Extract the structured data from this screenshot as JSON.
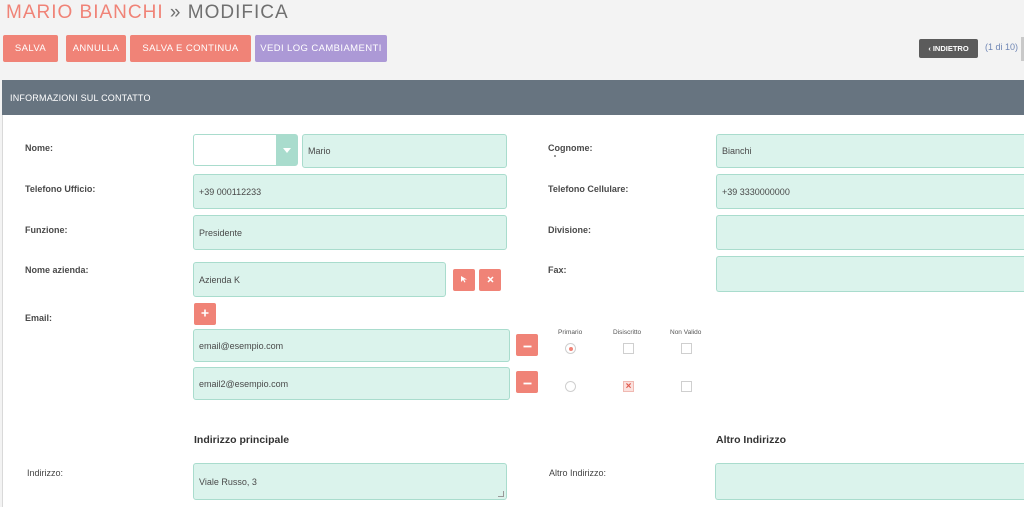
{
  "header": {
    "title_name": "MARIO BIANCHI",
    "title_sep": "»",
    "title_mode": "MODIFICA",
    "accent_color": "#f08377"
  },
  "toolbar": {
    "save_label": "SALVA",
    "cancel_label": "ANNULLA",
    "save_continue_label": "SALVA E CONTINUA",
    "changelog_label": "VEDI LOG CAMBIAMENTI",
    "back_label": "INDIETRO",
    "pager": "(1 di 10)"
  },
  "panel": {
    "title": "INFORMAZIONI SUL CONTATTO",
    "header_color": "#677480"
  },
  "fields": {
    "nome_label": "Nome:",
    "nome_value": "Mario",
    "cognome_label": "Cognome:",
    "cognome_value": "Bianchi",
    "tel_ufficio_label": "Telefono Ufficio:",
    "tel_ufficio_value": "+39 000112233",
    "tel_cellulare_label": "Telefono Cellulare:",
    "tel_cellulare_value": "+39 3330000000",
    "funzione_label": "Funzione:",
    "funzione_value": "Presidente",
    "divisione_label": "Divisione:",
    "divisione_value": "",
    "azienda_label": "Nome azienda:",
    "azienda_value": "Azienda K",
    "fax_label": "Fax:",
    "fax_value": "",
    "email_label": "Email:"
  },
  "email": {
    "col_primary": "Primario",
    "col_unsub": "Disiscritto",
    "col_invalid": "Non Valido",
    "rows": [
      {
        "value": "email@esempio.com",
        "primary": true,
        "unsubscribed": false,
        "invalid": false
      },
      {
        "value": "email2@esempio.com",
        "primary": false,
        "unsubscribed": true,
        "invalid": false
      }
    ]
  },
  "address": {
    "primary_title": "Indirizzo principale",
    "other_title": "Altro Indirizzo",
    "primary_label": "Indirizzo:",
    "primary_value": "Viale Russo, 3",
    "other_label": "Altro Indirizzo:",
    "other_value": ""
  }
}
